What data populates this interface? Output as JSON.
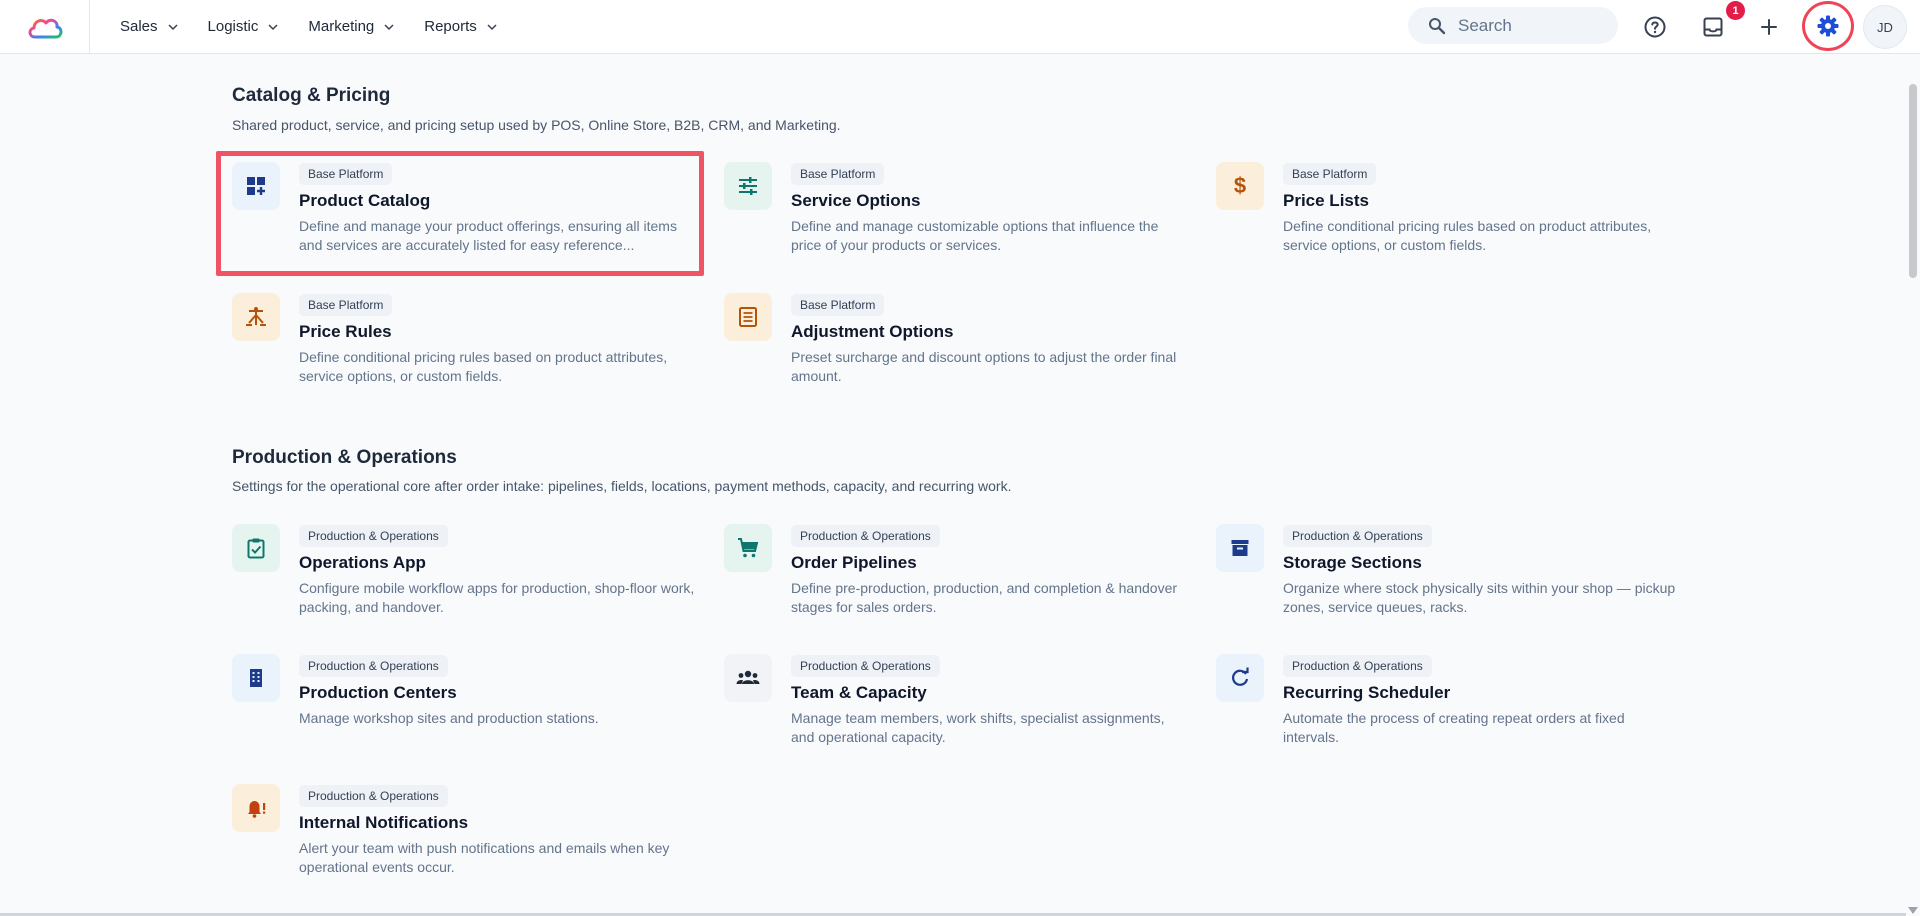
{
  "nav": {
    "items": [
      {
        "label": "Sales"
      },
      {
        "label": "Logistic"
      },
      {
        "label": "Marketing"
      },
      {
        "label": "Reports"
      }
    ],
    "search_placeholder": "Search",
    "inbox_badge": "1",
    "avatar_initials": "JD"
  },
  "sections": [
    {
      "title": "Catalog & Pricing",
      "description": "Shared product, service, and pricing setup used by POS, Online Store, B2B, CRM, and Marketing.",
      "cards": [
        {
          "tag": "Base Platform",
          "title": "Product Catalog",
          "description": "Define and manage your product offerings, ensuring all items and services are accurately listed for easy reference...",
          "icon": "dashboard-add-icon"
        },
        {
          "tag": "Base Platform",
          "title": "Service Options",
          "description": "Define and manage customizable options that influence the price of your products or services.",
          "icon": "tune-icon"
        },
        {
          "tag": "Base Platform",
          "title": "Price Lists",
          "description": "Define conditional pricing rules based on product attributes, service options, or custom fields.",
          "icon": "dollar-icon"
        },
        {
          "tag": "Base Platform",
          "title": "Price Rules",
          "description": "Define conditional pricing rules based on product attributes, service options, or custom fields.",
          "icon": "rules-icon"
        },
        {
          "tag": "Base Platform",
          "title": "Adjustment Options",
          "description": "Preset surcharge and discount options to adjust the order final amount.",
          "icon": "list-icon"
        }
      ]
    },
    {
      "title": "Production & Operations",
      "description": "Settings for the operational core after order intake: pipelines, fields, locations, payment methods, capacity, and recurring work.",
      "cards": [
        {
          "tag": "Production & Operations",
          "title": "Operations App",
          "description": "Configure mobile workflow apps for production, shop-floor work, packing, and handover.",
          "icon": "clipboard-check-icon"
        },
        {
          "tag": "Production & Operations",
          "title": "Order Pipelines",
          "description": "Define pre-production, production, and completion & handover stages for sales orders.",
          "icon": "cart-icon"
        },
        {
          "tag": "Production & Operations",
          "title": "Storage Sections",
          "description": "Organize where stock physically sits within your shop — pickup zones, service queues, racks.",
          "icon": "archive-icon"
        },
        {
          "tag": "Production & Operations",
          "title": "Production Centers",
          "description": "Manage workshop sites and production stations.",
          "icon": "building-icon"
        },
        {
          "tag": "Production & Operations",
          "title": "Team & Capacity",
          "description": "Manage team members, work shifts, specialist assignments, and operational capacity.",
          "icon": "people-icon"
        },
        {
          "tag": "Production & Operations",
          "title": "Recurring Scheduler",
          "description": "Automate the process of creating repeat orders at fixed intervals.",
          "icon": "refresh-icon"
        },
        {
          "tag": "Production & Operations",
          "title": "Internal Notifications",
          "description": "Alert your team with push notifications and emails when key operational events occur.",
          "icon": "bell-alert-icon"
        }
      ]
    }
  ]
}
